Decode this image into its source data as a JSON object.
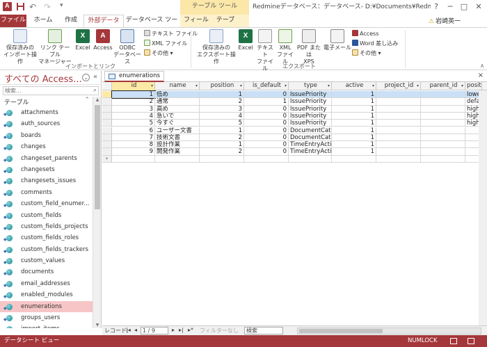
{
  "window": {
    "title": "Redmineデータベース：データベース- D:¥Documents¥Redmineデー...",
    "context_tab_header": "テーブル ツール",
    "help": "?",
    "user": "岩崎英一",
    "minimize": "─",
    "maximize": "□",
    "close": "✕"
  },
  "quick_access": {
    "undo": "↶",
    "redo": "↷",
    "dropdown": "▾"
  },
  "ribbon_tabs": {
    "file": "ファイル",
    "home": "ホーム",
    "create": "作成",
    "external": "外部データ",
    "dbtools": "データベース ツール",
    "fields": "フィールド",
    "table": "テーブル"
  },
  "ribbon": {
    "import_group": {
      "label": "インポートとリンク",
      "saved_imports": "保存済みの\nインポート操作",
      "linked_table_manager": "リンク テーブル\nマネージャー",
      "excel": "Excel",
      "access": "Access",
      "odbc": "ODBC\nデータベース",
      "text_file": "テキスト ファイル",
      "xml_file": "XML ファイル",
      "more": "その他 ▾"
    },
    "export_group": {
      "label": "エクスポート",
      "saved_exports": "保存済みの\nエクスポート操作",
      "excel": "Excel",
      "text_file": "テキスト\nファイル",
      "xml_file": "XML\nファイル",
      "pdf_xps": "PDF または\nXPS",
      "email": "電子メール",
      "access": "Access",
      "word_merge": "Word 差し込み",
      "more": "その他 ▾"
    },
    "collapse": "∧"
  },
  "nav_pane": {
    "title": "すべての Access...",
    "search_placeholder": "検索...",
    "group_label": "テーブル",
    "group_chevron": "⌃",
    "dropdown": "⌄",
    "collapse": "«",
    "items": [
      {
        "label": "attachments",
        "selected": false
      },
      {
        "label": "auth_sources",
        "selected": false
      },
      {
        "label": "boards",
        "selected": false
      },
      {
        "label": "changes",
        "selected": false
      },
      {
        "label": "changeset_parents",
        "selected": false
      },
      {
        "label": "changesets",
        "selected": false
      },
      {
        "label": "changesets_issues",
        "selected": false
      },
      {
        "label": "comments",
        "selected": false
      },
      {
        "label": "custom_field_enumer...",
        "selected": false
      },
      {
        "label": "custom_fields",
        "selected": false
      },
      {
        "label": "custom_fields_projects",
        "selected": false
      },
      {
        "label": "custom_fields_roles",
        "selected": false
      },
      {
        "label": "custom_fields_trackers",
        "selected": false
      },
      {
        "label": "custom_values",
        "selected": false
      },
      {
        "label": "documents",
        "selected": false
      },
      {
        "label": "email_addresses",
        "selected": false
      },
      {
        "label": "enabled_modules",
        "selected": false
      },
      {
        "label": "enumerations",
        "selected": true
      },
      {
        "label": "groups_users",
        "selected": false
      },
      {
        "label": "import_items",
        "selected": false
      }
    ]
  },
  "document": {
    "tab_label": "enumerations",
    "close": "×"
  },
  "datasheet": {
    "columns": [
      "id",
      "name",
      "position",
      "is_default",
      "type",
      "active",
      "project_id",
      "parent_id",
      "positi"
    ],
    "rows": [
      [
        "1",
        "低め",
        "1",
        "0",
        "IssuePriority",
        "1",
        "",
        "",
        "lowes"
      ],
      [
        "2",
        "通常",
        "2",
        "1",
        "IssuePriority",
        "1",
        "",
        "",
        "defau"
      ],
      [
        "3",
        "高め",
        "3",
        "0",
        "IssuePriority",
        "1",
        "",
        "",
        "high3"
      ],
      [
        "4",
        "急いで",
        "4",
        "0",
        "IssuePriority",
        "1",
        "",
        "",
        "high2"
      ],
      [
        "5",
        "今すぐ",
        "5",
        "0",
        "IssuePriority",
        "1",
        "",
        "",
        "highe"
      ],
      [
        "6",
        "ユーザー文書",
        "1",
        "0",
        "DocumentCate",
        "1",
        "",
        "",
        ""
      ],
      [
        "7",
        "技術文書",
        "2",
        "0",
        "DocumentCate",
        "1",
        "",
        "",
        ""
      ],
      [
        "8",
        "設計作業",
        "1",
        "0",
        "TimeEntryActi",
        "1",
        "",
        "",
        ""
      ],
      [
        "9",
        "開発作業",
        "2",
        "0",
        "TimeEntryActi",
        "1",
        "",
        "",
        ""
      ]
    ],
    "new_row_marker": "*"
  },
  "record_nav": {
    "label": "レコード:",
    "first": "|◂",
    "prev": "◂",
    "current": "1 / 9",
    "next": "▸",
    "last": "▸|",
    "new": "▸*",
    "filter": "フィルターなし",
    "search": "検索"
  },
  "statusbar": {
    "view": "データシート ビュー",
    "numlock": "NUMLOCK"
  },
  "colors": {
    "accent": "#a4373a",
    "selected_row": "#c9e0f7",
    "nav_selected": "#f6c6c6"
  }
}
